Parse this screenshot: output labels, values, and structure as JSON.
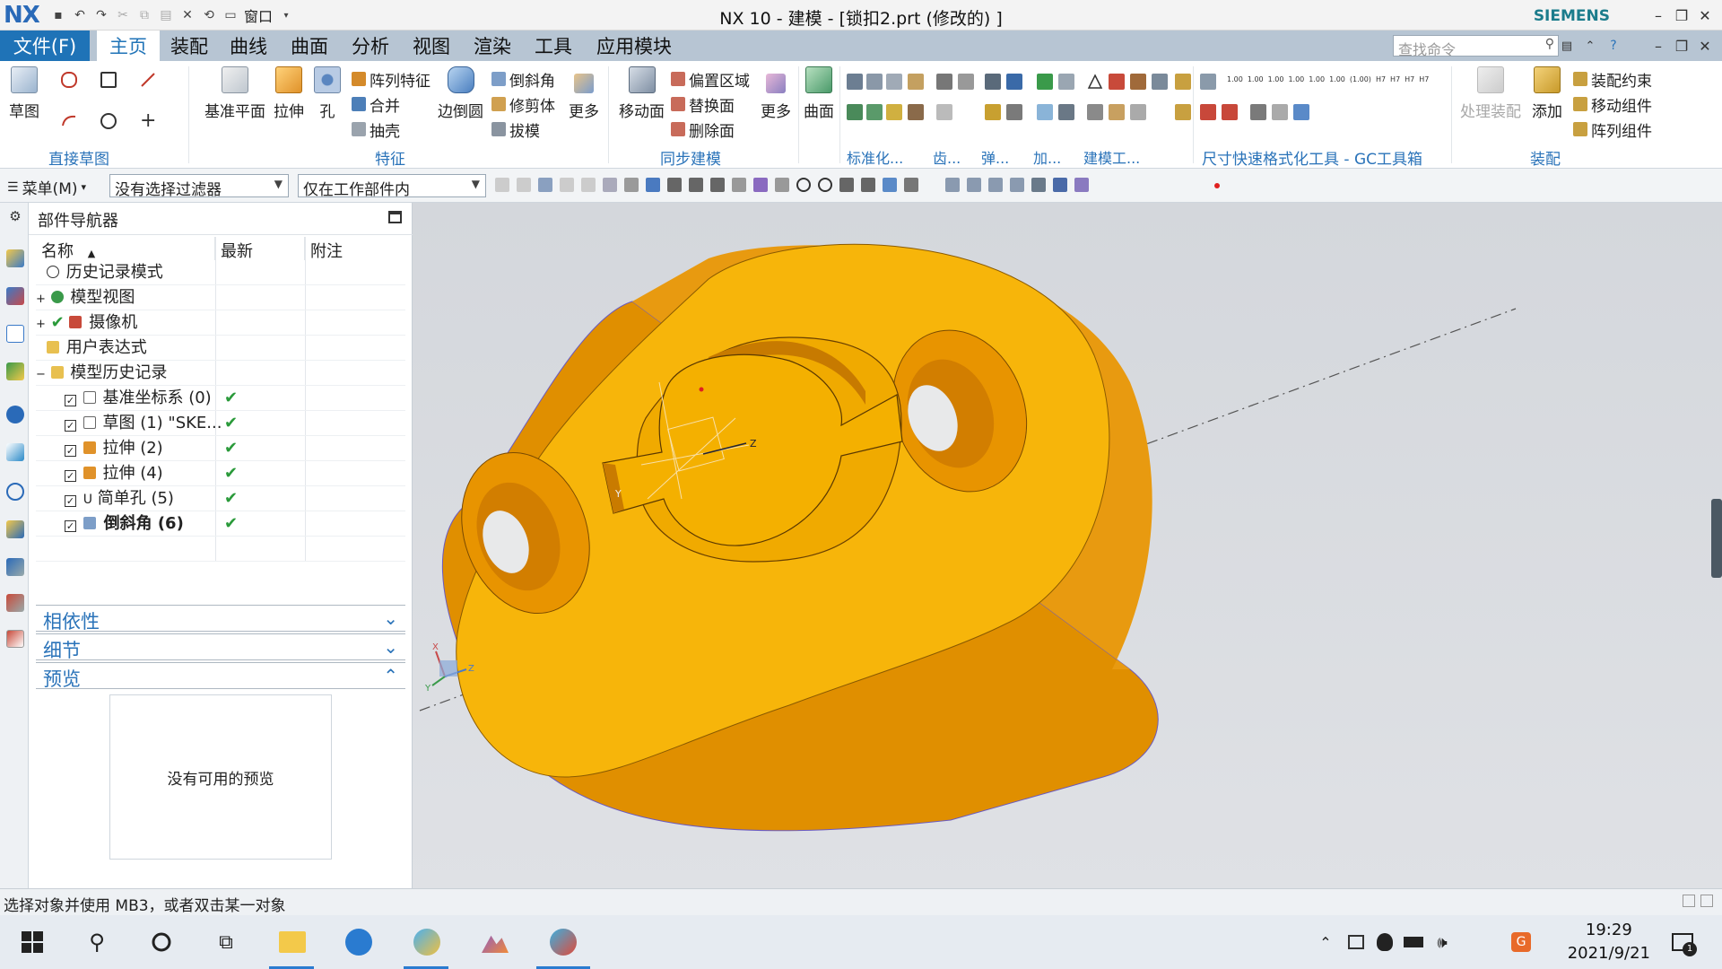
{
  "titlebar": {
    "logo": "NX",
    "window_menu": "窗口",
    "title": "NX 10 - 建模 - [锁扣2.prt  (修改的) ]",
    "brand": "SIEMENS"
  },
  "tabs": {
    "file": "文件(F)",
    "items": [
      "主页",
      "装配",
      "曲线",
      "曲面",
      "分析",
      "视图",
      "渲染",
      "工具",
      "应用模块"
    ],
    "active": "主页",
    "search_placeholder": "查找命令"
  },
  "ribbon": {
    "sketch": {
      "label": "草图",
      "group": "直接草图"
    },
    "feature": {
      "datum_plane": "基准平面",
      "extrude": "拉伸",
      "hole": "孔",
      "pattern": "阵列特征",
      "unite": "合并",
      "shell": "抽壳",
      "edge_blend": "边倒圆",
      "chamfer": "倒斜角",
      "trim_body": "修剪体",
      "draft": "拔模",
      "more": "更多",
      "group": "特征"
    },
    "sync": {
      "move_face": "移动面",
      "offset_region": "偏置区域",
      "replace_face": "替换面",
      "delete_face": "删除面",
      "more": "更多",
      "group": "同步建模"
    },
    "surface": {
      "label": "曲面"
    },
    "groups_small": [
      "标准化...",
      "齿...",
      "弹...",
      "加...",
      "建模工..."
    ],
    "gc_group": "尺寸快速格式化工具 - GC工具箱",
    "gc_values": [
      "1.00",
      "1.00",
      "1.00",
      "1.00",
      "1.00",
      "1.00",
      "(1.00)",
      "H7",
      "H7",
      "H7",
      "H7"
    ],
    "assembly": {
      "process": "处理装配",
      "add": "添加",
      "constraint": "装配约束",
      "move_component": "移动组件",
      "pattern_component": "阵列组件",
      "group": "装配"
    }
  },
  "selection_bar": {
    "menu": "菜单(M)",
    "filter": "没有选择过滤器",
    "scope": "仅在工作部件内"
  },
  "navigator": {
    "title": "部件导航器",
    "columns": [
      "名称",
      "最新",
      "附注"
    ],
    "rows": [
      {
        "label": "历史记录模式",
        "latest": ""
      },
      {
        "label": "模型视图",
        "latest": ""
      },
      {
        "label": "摄像机",
        "latest": ""
      },
      {
        "label": "用户表达式",
        "latest": ""
      },
      {
        "label": "模型历史记录",
        "latest": ""
      },
      {
        "label": "基准坐标系 (0)",
        "latest": "✔"
      },
      {
        "label": "草图 (1) \"SKE...",
        "latest": "✔"
      },
      {
        "label": "拉伸 (2)",
        "latest": "✔"
      },
      {
        "label": "拉伸 (4)",
        "latest": "✔"
      },
      {
        "label": "简单孔 (5)",
        "latest": "✔"
      },
      {
        "label": "倒斜角 (6)",
        "latest": "✔"
      }
    ],
    "panels": {
      "dependency": "相依性",
      "details": "细节",
      "preview": "预览",
      "no_preview": "没有可用的预览"
    }
  },
  "viewport": {
    "triad_labels": [
      "X",
      "Y",
      "Z"
    ],
    "csys_labels": [
      "Y",
      "Z"
    ],
    "part_color": "#f5b400"
  },
  "status": {
    "message": "选择对象并使用 MB3，或者双击某一对象"
  },
  "taskbar": {
    "time": "19:29",
    "date": "2021/9/21",
    "notifications": "1"
  }
}
